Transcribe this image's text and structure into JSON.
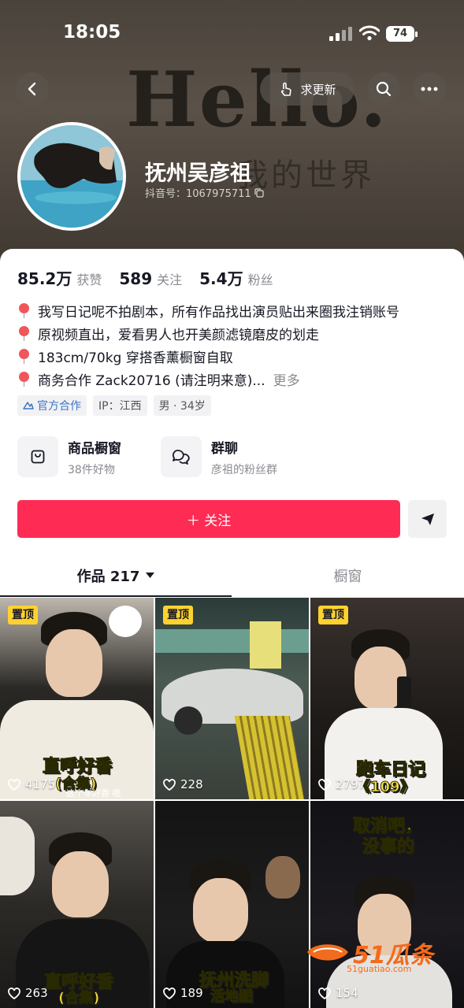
{
  "status_bar": {
    "time": "18:05",
    "battery": "74"
  },
  "header": {
    "request_update_label": "求更新",
    "background_text": "Hello.",
    "background_subtext": "我的世界"
  },
  "profile": {
    "name": "抚州吴彦祖",
    "douyin_id": "抖音号：1067975711"
  },
  "stats": [
    {
      "value": "85.2万",
      "label": "获赞"
    },
    {
      "value": "589",
      "label": "关注"
    },
    {
      "value": "5.4万",
      "label": "粉丝"
    }
  ],
  "bio": [
    "我写日记呢不拍剧本，所有作品找出演员贴出来圈我注销账号",
    "原视频直出，爱看男人也开美颜滤镜磨皮的划走",
    "183cm/70kg 穿搭香薰橱窗自取",
    "商务合作 Zack20716 (请注明来意)..."
  ],
  "bio_more": "更多",
  "tags": [
    "官方合作",
    "IP：江西",
    "男 · 34岁"
  ],
  "features": [
    {
      "title": "商品橱窗",
      "subtitle": "38件好物"
    },
    {
      "title": "群聊",
      "subtitle": "彦祖的粉丝群"
    }
  ],
  "follow_label": "＋ 关注",
  "tabs": {
    "works": "作品 217",
    "showcase": "橱窗"
  },
  "videos": [
    {
      "pinned": "置顶",
      "likes": "4175",
      "caption": "直呼好香",
      "caption2": "(合集)",
      "small": "这个车好香  嗯"
    },
    {
      "pinned": "置顶",
      "likes": "228",
      "caption": "",
      "caption2": "",
      "small": ""
    },
    {
      "pinned": "置顶",
      "likes": "2797",
      "caption": "跑车日记",
      "caption2": "《109》",
      "small": ""
    },
    {
      "pinned": "",
      "likes": "263",
      "caption": "直呼好香",
      "caption2": "(合集)",
      "small": ""
    },
    {
      "pinned": "",
      "likes": "189",
      "caption": "抚州洗脚",
      "caption2": "活地图",
      "small": ""
    },
    {
      "pinned": "",
      "likes": "154",
      "caption": "取消吧，",
      "caption2": "没事的",
      "small": ""
    }
  ],
  "watermark": {
    "brand": "51瓜条",
    "url": "51guatiao.com"
  },
  "colors": {
    "accent": "#fe2c55",
    "pinned": "#fdd22f"
  }
}
